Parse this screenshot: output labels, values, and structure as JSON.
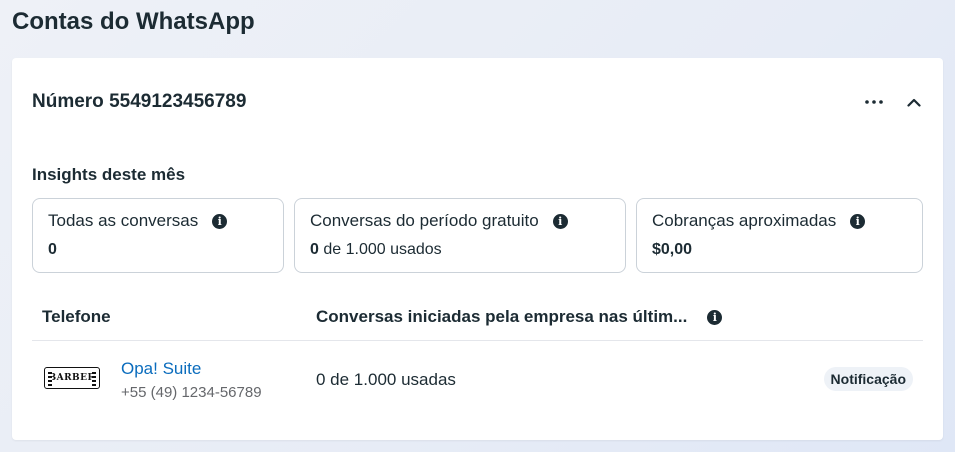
{
  "page": {
    "title": "Contas do WhatsApp"
  },
  "account": {
    "label": "Número 5549123456789",
    "more_icon": "more-horizontal-icon",
    "collapse_icon": "chevron-up-icon"
  },
  "insights": {
    "title": "Insights deste mês",
    "cards": [
      {
        "label": "Todas as conversas",
        "value_bold": "0",
        "value_rest": ""
      },
      {
        "label": "Conversas do período gratuito",
        "value_bold": "0",
        "value_rest": " de 1.000 usados"
      },
      {
        "label": "Cobranças aproximadas",
        "value_bold": "$0,00",
        "value_rest": ""
      }
    ]
  },
  "table": {
    "headers": {
      "phone": "Telefone",
      "conversations": "Conversas iniciadas pela empresa nas últim..."
    },
    "rows": [
      {
        "avatar_text": "BARBER",
        "name": "Opa! Suite",
        "phone": "+55 (49) 1234-56789",
        "usage": "0 de 1.000 usadas",
        "badge": "Notificação"
      }
    ]
  },
  "colors": {
    "link": "#0a6cbd",
    "text": "#1c2b33",
    "muted": "#65676b",
    "border": "#cbd2d9"
  }
}
